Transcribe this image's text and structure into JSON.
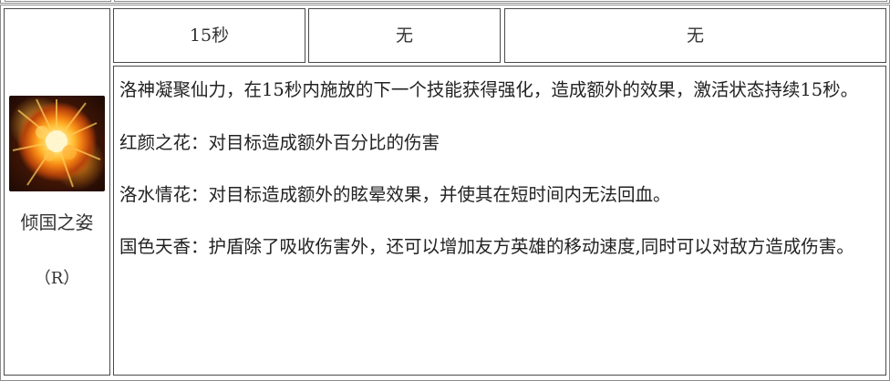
{
  "skill": {
    "name": "倾国之姿",
    "key": "（R）",
    "icon": "explosion-flame-icon"
  },
  "stats": {
    "cooldown": "15秒",
    "cost": "无",
    "extra": "无"
  },
  "description": {
    "intro": "洛神凝聚仙力，在15秒内施放的下一个技能获得强化，造成额外的效果，激活状态持续15秒。",
    "effects": [
      "红颜之花：对目标造成额外百分比的伤害",
      "洛水情花：对目标造成额外的眩晕效果，并使其在短时间内无法回血。",
      "国色天香：护盾除了吸收伤害外，还可以增加友方英雄的移动速度,同时可以对敌方造成伤害。"
    ]
  },
  "colors": {
    "border": "#4a4a4a",
    "outer_border": "#8c8c8c",
    "text": "#222222",
    "icon_core": "#ffe27a",
    "icon_glow": "#f07d12"
  }
}
